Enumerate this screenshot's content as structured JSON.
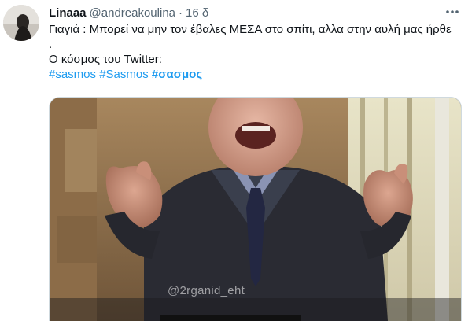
{
  "tweet": {
    "display_name": "Linaaa",
    "handle": "@andreakoulina",
    "separator": "·",
    "time": "16 δ",
    "text_line1": "Γιαγιά : Μπορεί να μην τον έβαλες ΜΕΣΑ στο σπίτι, αλλα στην αυλή μας ήρθε .",
    "text_line2": "Ο κόσμος του Twitter:",
    "hashtags": [
      "#sasmos",
      "#Sasmos",
      "#σασμος"
    ],
    "more_icon": "more-horizontal-icon",
    "media": {
      "watermark": "@2rganid_eht"
    }
  },
  "colors": {
    "link": "#1d9bf0",
    "text": "#0f1419",
    "muted": "#536471"
  }
}
